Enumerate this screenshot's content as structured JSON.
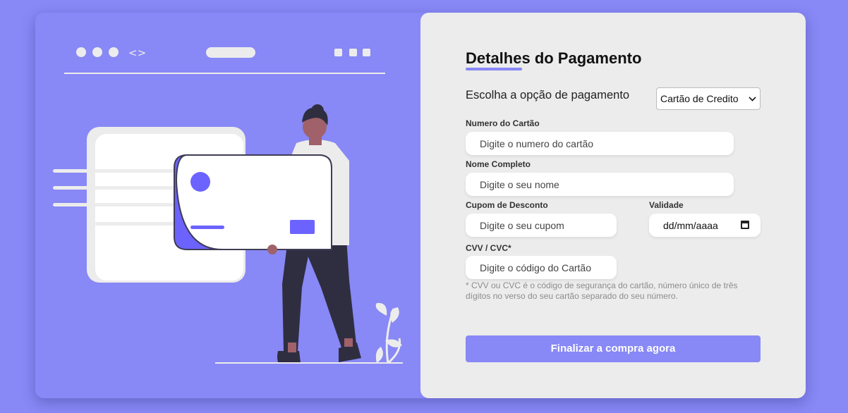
{
  "illustration": {
    "browser_bar_code_glyph": "<>"
  },
  "form": {
    "title": "Detalhes do Pagamento",
    "payment_option_label": "Escolha a opção de pagamento",
    "payment_option_selected": "Cartão de Credito",
    "card_number": {
      "label": "Numero do Cartão",
      "placeholder": "Digite o numero do cartão"
    },
    "full_name": {
      "label": "Nome Completo",
      "placeholder": "Digite o seu nome"
    },
    "coupon": {
      "label": "Cupom de Desconto",
      "placeholder": "Digite o seu cupom"
    },
    "validity": {
      "label": "Validade",
      "placeholder": "dd/mm/aaaa"
    },
    "cvv": {
      "label": "CVV / CVC*",
      "placeholder": "Digite o código do Cartão"
    },
    "note": "* CVV ou CVC é o código de segurança do cartão, número único de três dígitos no verso do seu cartão separado do seu número.",
    "submit_label": "Finalizar a compra agora"
  },
  "colors": {
    "accent": "#8888f6",
    "card_accent": "#6c63ff",
    "panel_bg": "#ececec",
    "figure_dark": "#2f2e41"
  }
}
